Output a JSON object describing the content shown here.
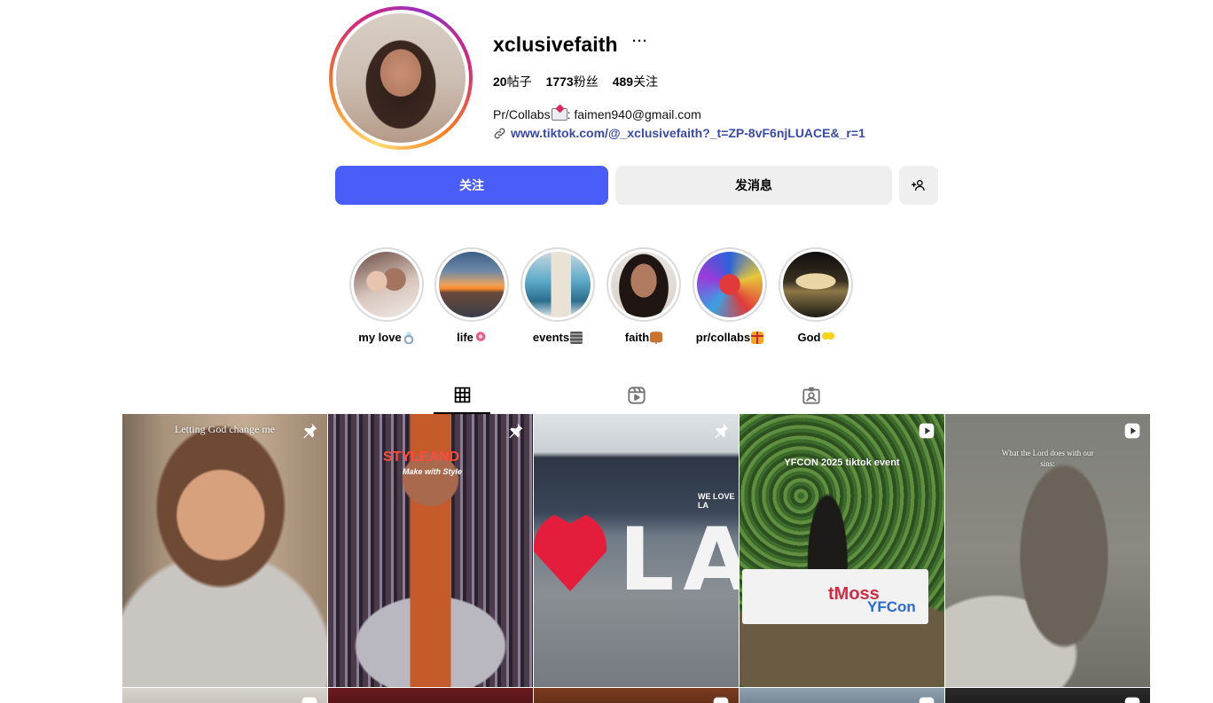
{
  "profile": {
    "username": "xclusivefaith",
    "more_label": "···",
    "stats": {
      "posts_count": "20",
      "posts_label": "帖子",
      "followers_count": "1773",
      "followers_label": "粉丝",
      "following_count": "489",
      "following_label": "关注"
    },
    "bio_prefix": "Pr/Collabs",
    "bio_suffix": ": faimen940@gmail.com",
    "link": "www.tiktok.com/@_xclusivefaith?_t=ZP-8vF6njLUACE&_r=1"
  },
  "actions": {
    "follow_label": "关注",
    "message_label": "发消息"
  },
  "highlights": [
    {
      "label": "my love",
      "emoji": "ring-emoji"
    },
    {
      "label": "life",
      "emoji": "flower-emoji"
    },
    {
      "label": "events",
      "emoji": "newspaper-emoji"
    },
    {
      "label": "faith",
      "emoji": "butterfly-emoji"
    },
    {
      "label": "pr/collabs",
      "emoji": "gift-emoji"
    },
    {
      "label": "God",
      "emoji": "yellow-heart-emoji"
    }
  ],
  "tabs": [
    {
      "name": "posts",
      "icon": "grid-icon",
      "active": true
    },
    {
      "name": "reels",
      "icon": "reels-icon",
      "active": false
    },
    {
      "name": "tagged",
      "icon": "tagged-icon",
      "active": false
    }
  ],
  "posts": [
    {
      "caption": "Letting God change me",
      "badge": "pin-icon"
    },
    {
      "sign_text": "STYLEAND",
      "sign_sub": "Make with Style",
      "badge": "pin-icon"
    },
    {
      "sign_text": "WE LOVE LA",
      "big_letters": "LA",
      "badge": "pin-icon"
    },
    {
      "caption": "YFCON 2025 tiktok event",
      "banner_text": "YFCon",
      "banner_left": "tMoss",
      "badge": "reel-icon"
    },
    {
      "caption": "What the Lord does with our sins:",
      "badge": "reel-icon"
    }
  ],
  "colors": {
    "accent": "#4a5df9",
    "link": "#3949ab",
    "secondary_button": "#efefef",
    "highlight_ring": "#dbdbdb"
  }
}
